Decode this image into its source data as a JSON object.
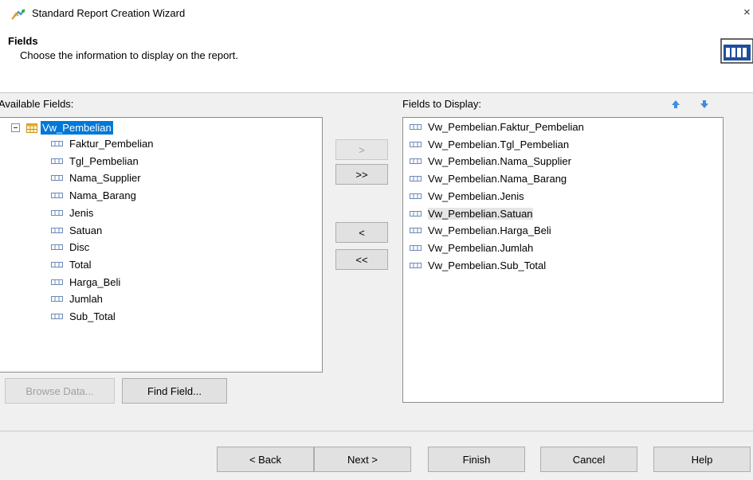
{
  "window": {
    "title": "Standard Report Creation Wizard",
    "close_glyph": "×"
  },
  "header": {
    "title": "Fields",
    "subtitle": "Choose the information to display on the report."
  },
  "available": {
    "label": "Available Fields:",
    "root": "Vw_Pembelian",
    "items": [
      "Faktur_Pembelian",
      "Tgl_Pembelian",
      "Nama_Supplier",
      "Nama_Barang",
      "Jenis",
      "Satuan",
      "Disc",
      "Total",
      "Harga_Beli",
      "Jumlah",
      "Sub_Total"
    ]
  },
  "display": {
    "label": "Fields to Display:",
    "selected_item": "Vw_Pembelian.Satuan",
    "items": [
      "Vw_Pembelian.Faktur_Pembelian",
      "Vw_Pembelian.Tgl_Pembelian",
      "Vw_Pembelian.Nama_Supplier",
      "Vw_Pembelian.Nama_Barang",
      "Vw_Pembelian.Jenis",
      "Vw_Pembelian.Satuan",
      "Vw_Pembelian.Harga_Beli",
      "Vw_Pembelian.Jumlah",
      "Vw_Pembelian.Sub_Total"
    ]
  },
  "transfer": {
    "add": ">",
    "add_all": ">>",
    "remove": "<",
    "remove_all": "<<"
  },
  "buttons": {
    "browse": "Browse Data...",
    "find": "Find Field...",
    "back": "< Back",
    "next": "Next >",
    "finish": "Finish",
    "cancel": "Cancel",
    "help": "Help"
  },
  "icons": {
    "app": "wizard-arrow-icon",
    "report": "report-table-icon",
    "root": "table-icon",
    "field": "field-icon",
    "up": "move-up-arrow-icon",
    "down": "move-down-arrow-icon"
  },
  "colors": {
    "selection": "#0078d7",
    "dialog_bg": "#f0f0f0",
    "arrow_blue": "#3b8ede"
  }
}
